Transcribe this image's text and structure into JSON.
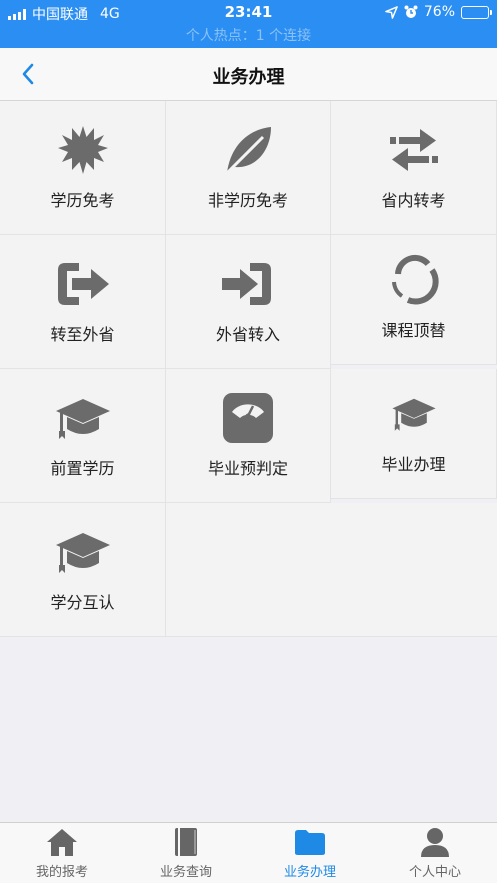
{
  "status_bar": {
    "carrier": "中国联通",
    "network": "4G",
    "time": "23:41",
    "battery": "76%",
    "battery_level": 0.76,
    "hotspot": "个人热点：1 个连接"
  },
  "nav": {
    "title": "业务办理"
  },
  "services": [
    {
      "label": "学历免考",
      "icon": "starburst-icon"
    },
    {
      "label": "非学历免考",
      "icon": "leaf-icon"
    },
    {
      "label": "省内转考",
      "icon": "swap-arrows-icon"
    },
    {
      "label": "转至外省",
      "icon": "sign-out-icon"
    },
    {
      "label": "外省转入",
      "icon": "sign-in-icon"
    },
    {
      "label": "课程顶替",
      "icon": "circle-arrows-icon"
    },
    {
      "label": "前置学历",
      "icon": "graduation-cap-icon"
    },
    {
      "label": "毕业预判定",
      "icon": "scale-icon"
    },
    {
      "label": "毕业办理",
      "icon": "graduation-cap-icon"
    },
    {
      "label": "学分互认",
      "icon": "graduation-cap-icon"
    }
  ],
  "tabs": [
    {
      "label": "我的报考",
      "icon": "home-icon",
      "active": false
    },
    {
      "label": "业务查询",
      "icon": "book-icon",
      "active": false
    },
    {
      "label": "业务办理",
      "icon": "folder-icon",
      "active": true
    },
    {
      "label": "个人中心",
      "icon": "user-icon",
      "active": false
    }
  ],
  "colors": {
    "status_bar": "#2a8ef2",
    "accent": "#1e8ae6",
    "icon_gray": "#6b6b6b"
  }
}
